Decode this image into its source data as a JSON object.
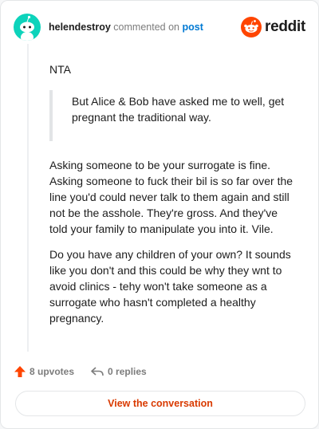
{
  "header": {
    "username": "helendestroy",
    "action": "commented on",
    "link": "post",
    "logo_text": "reddit"
  },
  "comment": {
    "verdict": "NTA",
    "quote": "But Alice & Bob have asked me to well, get pregnant the traditional way.",
    "paragraphs": [
      "Asking someone to be your surrogate is fine. Asking someone to fuck their bil is so far over the line you'd could never talk to them again and still not be the asshole. They're gross. And they've told your family to manipulate you into it. Vile.",
      "Do you have any children of your own? It sounds like you don't and this could be why they wnt to avoid clinics - tehy won't take someone as a surrogate who hasn't completed a healthy pregnancy."
    ]
  },
  "footer": {
    "upvotes": "8 upvotes",
    "replies": "0 replies"
  },
  "cta": {
    "label": "View the conversation"
  },
  "colors": {
    "accent": "#ff4500",
    "link": "#0079d3",
    "avatar": "#0dd3bb"
  }
}
